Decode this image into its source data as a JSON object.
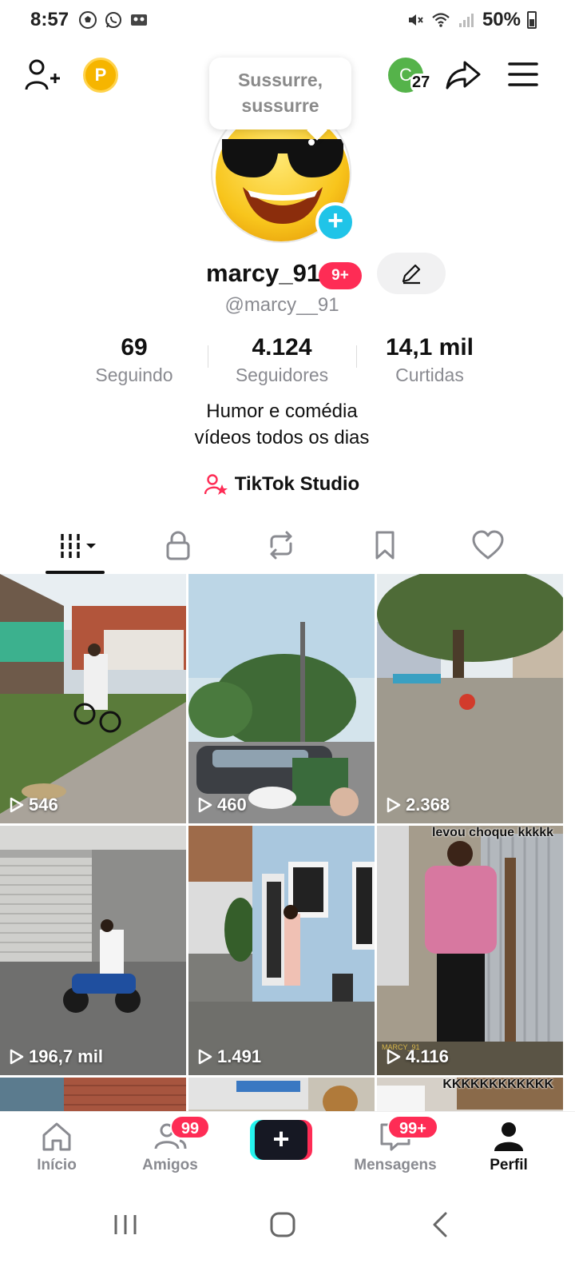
{
  "status_bar": {
    "time": "8:57",
    "battery": "50%",
    "left_icons": [
      "soccer-ball-icon",
      "whatsapp-icon",
      "voicemail-icon"
    ],
    "right_icons": [
      "mute-icon",
      "wifi-icon",
      "signal-icon",
      "battery-icon"
    ]
  },
  "header": {
    "coin_letter": "P",
    "note_bubble": "Sussurre, sussurre",
    "creator_letter": "C",
    "creator_count": "27"
  },
  "profile": {
    "display_name": "marcy_91",
    "badge": "9+",
    "handle": "@marcy__91",
    "bio_line1": "Humor e comédia",
    "bio_line2": "vídeos todos os dias",
    "studio_label": "TikTok Studio"
  },
  "stats": [
    {
      "value": "69",
      "label": "Seguindo"
    },
    {
      "value": "4.124",
      "label": "Seguidores"
    },
    {
      "value": "14,1 mil",
      "label": "Curtidas"
    }
  ],
  "tabs": [
    "videos-grid",
    "private",
    "reposts",
    "favorites",
    "liked"
  ],
  "videos": [
    {
      "views": "546",
      "caption": ""
    },
    {
      "views": "460",
      "caption": ""
    },
    {
      "views": "2.368",
      "caption": ""
    },
    {
      "views": "196,7 mil",
      "caption": ""
    },
    {
      "views": "1.491",
      "caption": ""
    },
    {
      "views": "4.116",
      "caption": "levou choque kkkkk",
      "watermark": "MARCY_91"
    },
    {
      "views": "",
      "caption": ""
    },
    {
      "views": "",
      "caption": ""
    },
    {
      "views": "",
      "caption": "KKKKKKKKKKKK"
    }
  ],
  "bottom_nav": {
    "home": "Início",
    "friends": "Amigos",
    "friends_badge": "99",
    "messages": "Mensagens",
    "messages_badge": "99+",
    "profile": "Perfil"
  },
  "colors": {
    "accent": "#fe2c55",
    "cyan": "#25f4ee",
    "muted_text": "#8a8b91",
    "avatar_plus": "#20c4e8"
  }
}
